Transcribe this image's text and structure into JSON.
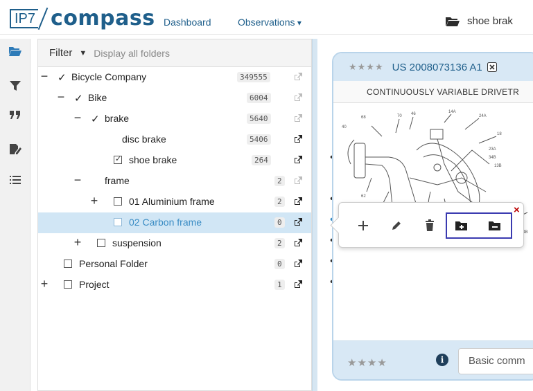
{
  "header": {
    "logo_box": "IP7",
    "logo_word": "compass",
    "nav_dashboard": "Dashboard",
    "nav_observations": "Observations",
    "current_folder": "shoe brak"
  },
  "filter": {
    "label": "Filter",
    "placeholder": "Display all folders"
  },
  "tree": {
    "rows": [
      {
        "label": "Bicycle Company",
        "count": "349555"
      },
      {
        "label": "Bike",
        "count": "6004"
      },
      {
        "label": "brake",
        "count": "5640"
      },
      {
        "label": "disc brake",
        "count": "5406"
      },
      {
        "label": "shoe brake",
        "count": "264"
      },
      {
        "label": "frame",
        "count": "2"
      },
      {
        "label": "01 Aluminium frame",
        "count": "2"
      },
      {
        "label": "02 Carbon frame",
        "count": "0"
      },
      {
        "label": "suspension",
        "count": "2"
      },
      {
        "label": "Personal Folder",
        "count": "0"
      },
      {
        "label": "Project",
        "count": "1"
      }
    ]
  },
  "document": {
    "stars": "★★★★",
    "patent_number": "US 2008073136 A1",
    "title": "CONTINUOUSLY VARIABLE DRIVETR",
    "footer_stars": "★★★★",
    "comment_placeholder": "Basic comm"
  },
  "popover": {
    "close": "×"
  },
  "colors": {
    "accent": "#1f5f8b",
    "selected_row": "#d1e6f5",
    "card_header": "#d8e8f5",
    "highlight_box": "#3a3ab0",
    "close_x": "#b00000"
  },
  "icons": {
    "rail": [
      "folder-open-icon",
      "filter-icon",
      "quote-icon",
      "signature-icon",
      "list-icon"
    ],
    "tree_row_action": "external-link-icon",
    "popover": [
      "plus-icon",
      "pencil-icon",
      "trash-icon",
      "folder-plus-icon",
      "folder-minus-icon"
    ]
  }
}
